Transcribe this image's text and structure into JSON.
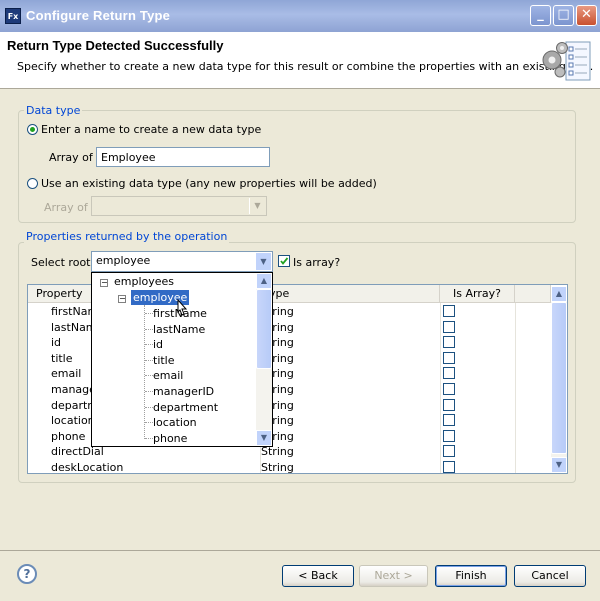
{
  "window": {
    "app_icon_text": "Fx",
    "title": "Configure Return Type",
    "min_glyph": "_",
    "max_glyph": "□",
    "close_glyph": "✕"
  },
  "header": {
    "title": "Return Type Detected Successfully",
    "description": "Specify whether to create a new data type for this result or combine the properties with an existing one.",
    "graphic_icon": "gears-checklist-icon"
  },
  "data_type": {
    "legend": "Data type",
    "new_option_label": "Enter a name to create a new data type",
    "new_option_selected": true,
    "array_of_label": "Array of",
    "array_of_value": "Employee",
    "existing_option_label": "Use an existing data type (any new properties will be added)",
    "existing_option_selected": false,
    "existing_array_of_label": "Array of",
    "existing_array_of_value": ""
  },
  "properties": {
    "legend": "Properties returned by the operation",
    "select_root_label": "Select root:",
    "select_root_value": "employee",
    "is_array_label": "Is array?",
    "is_array_checked": true,
    "columns": [
      "Property",
      "Type",
      "Is Array?"
    ],
    "rows": [
      {
        "property": "firstName",
        "type": "String",
        "is_array": false
      },
      {
        "property": "lastName",
        "type": "String",
        "is_array": false
      },
      {
        "property": "id",
        "type": "String",
        "is_array": false
      },
      {
        "property": "title",
        "type": "String",
        "is_array": false
      },
      {
        "property": "email",
        "type": "String",
        "is_array": false
      },
      {
        "property": "managerID",
        "type": "String",
        "is_array": false
      },
      {
        "property": "department",
        "type": "String",
        "is_array": false
      },
      {
        "property": "location",
        "type": "String",
        "is_array": false
      },
      {
        "property": "phone",
        "type": "String",
        "is_array": false
      },
      {
        "property": "directDial",
        "type": "String",
        "is_array": false
      },
      {
        "property": "deskLocation",
        "type": "String",
        "is_array": false
      }
    ]
  },
  "root_tree": {
    "root": "employees",
    "selected": "employee",
    "children": [
      "firstName",
      "lastName",
      "id",
      "title",
      "email",
      "managerID",
      "department",
      "location",
      "phone"
    ]
  },
  "buttons": {
    "help": "?",
    "back": "< Back",
    "next": "Next >",
    "finish": "Finish",
    "cancel": "Cancel"
  },
  "colors": {
    "title_bar": "#8fa6d6",
    "legend_text": "#0046d5",
    "selection": "#316ac5",
    "dialog_bg": "#ece9d8"
  }
}
